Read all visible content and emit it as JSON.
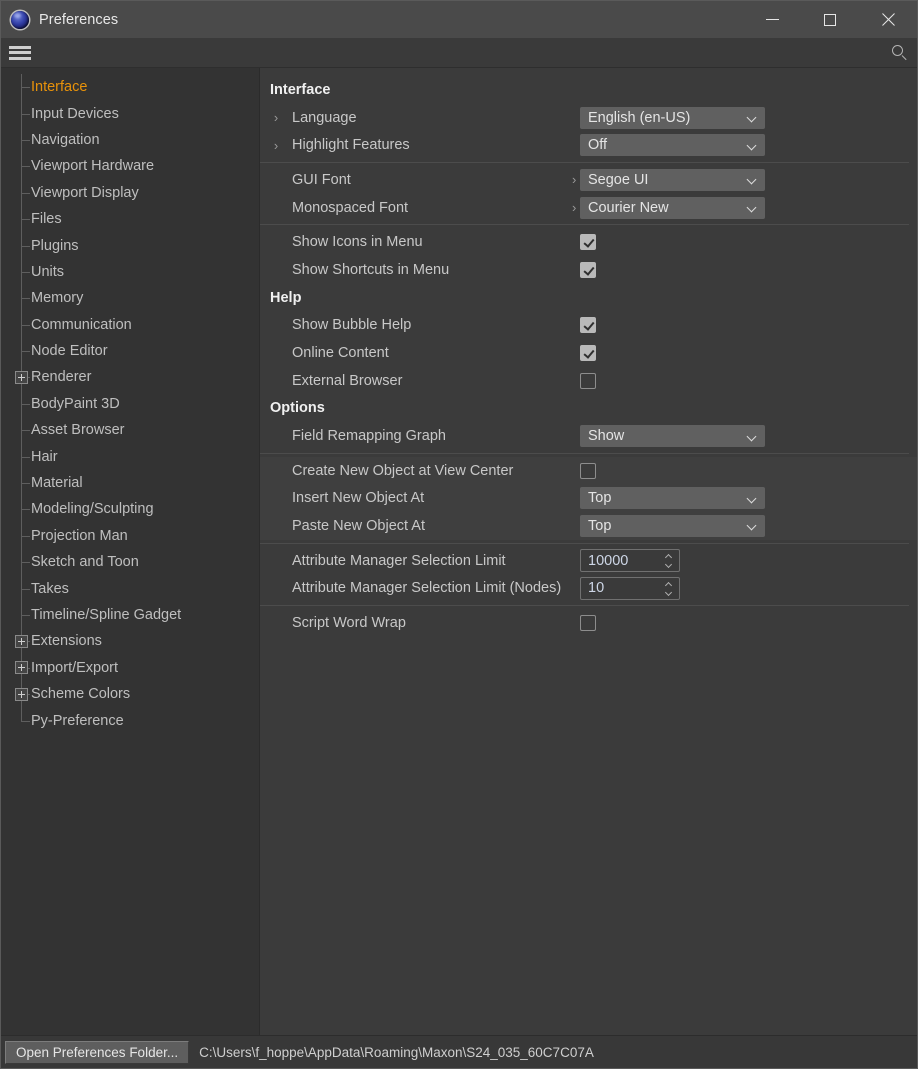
{
  "window": {
    "title": "Preferences",
    "app_icon": "cinema4d-logo-icon",
    "minimize_label": "–",
    "maximize_label": "□",
    "close_label": "×"
  },
  "toolbar": {
    "menu_icon": "hamburger-menu-icon",
    "search_icon": "search-icon"
  },
  "sidebar": {
    "items": [
      {
        "label": "Interface",
        "expandable": false,
        "selected": true,
        "last": false
      },
      {
        "label": "Input Devices",
        "expandable": false,
        "selected": false,
        "last": false
      },
      {
        "label": "Navigation",
        "expandable": false,
        "selected": false,
        "last": false
      },
      {
        "label": "Viewport Hardware",
        "expandable": false,
        "selected": false,
        "last": false
      },
      {
        "label": "Viewport Display",
        "expandable": false,
        "selected": false,
        "last": false
      },
      {
        "label": "Files",
        "expandable": false,
        "selected": false,
        "last": false
      },
      {
        "label": "Plugins",
        "expandable": false,
        "selected": false,
        "last": false
      },
      {
        "label": "Units",
        "expandable": false,
        "selected": false,
        "last": false
      },
      {
        "label": "Memory",
        "expandable": false,
        "selected": false,
        "last": false
      },
      {
        "label": "Communication",
        "expandable": false,
        "selected": false,
        "last": false
      },
      {
        "label": "Node Editor",
        "expandable": false,
        "selected": false,
        "last": false
      },
      {
        "label": "Renderer",
        "expandable": true,
        "selected": false,
        "last": false
      },
      {
        "label": "BodyPaint 3D",
        "expandable": false,
        "selected": false,
        "last": false
      },
      {
        "label": "Asset Browser",
        "expandable": false,
        "selected": false,
        "last": false
      },
      {
        "label": "Hair",
        "expandable": false,
        "selected": false,
        "last": false
      },
      {
        "label": "Material",
        "expandable": false,
        "selected": false,
        "last": false
      },
      {
        "label": "Modeling/Sculpting",
        "expandable": false,
        "selected": false,
        "last": false
      },
      {
        "label": "Projection Man",
        "expandable": false,
        "selected": false,
        "last": false
      },
      {
        "label": "Sketch and Toon",
        "expandable": false,
        "selected": false,
        "last": false
      },
      {
        "label": "Takes",
        "expandable": false,
        "selected": false,
        "last": false
      },
      {
        "label": "Timeline/Spline Gadget",
        "expandable": false,
        "selected": false,
        "last": false
      },
      {
        "label": "Extensions",
        "expandable": true,
        "selected": false,
        "last": false
      },
      {
        "label": "Import/Export",
        "expandable": true,
        "selected": false,
        "last": false
      },
      {
        "label": "Scheme Colors",
        "expandable": true,
        "selected": false,
        "last": false
      },
      {
        "label": "Py-Preference",
        "expandable": false,
        "selected": false,
        "last": true
      }
    ]
  },
  "content": {
    "sections": [
      {
        "heading": "Interface",
        "rows": [
          {
            "kind": "dropdown",
            "arrow": true,
            "label": "Language",
            "value": "English (en-US)"
          },
          {
            "kind": "dropdown",
            "arrow": true,
            "label": "Highlight Features",
            "value": "Off"
          },
          {
            "kind": "sep"
          },
          {
            "kind": "dropdown",
            "arrow": false,
            "pre_arrow": true,
            "label": "GUI Font",
            "value": "Segoe UI"
          },
          {
            "kind": "dropdown",
            "arrow": false,
            "pre_arrow": true,
            "label": "Monospaced Font",
            "value": "Courier New"
          },
          {
            "kind": "sep"
          },
          {
            "kind": "checkbox",
            "label": "Show Icons in Menu",
            "checked": true
          },
          {
            "kind": "checkbox",
            "label": "Show Shortcuts in Menu",
            "checked": true
          }
        ]
      },
      {
        "heading": "Help",
        "rows": [
          {
            "kind": "checkbox",
            "label": "Show Bubble Help",
            "checked": true
          },
          {
            "kind": "checkbox",
            "label": "Online Content",
            "checked": true
          },
          {
            "kind": "checkbox",
            "label": "External Browser",
            "checked": false
          }
        ]
      },
      {
        "heading": "Options",
        "rows": [
          {
            "kind": "dropdown",
            "arrow": false,
            "label": "Field Remapping Graph",
            "value": "Show"
          },
          {
            "kind": "sep"
          },
          {
            "kind": "checkbox",
            "label": "Create New Object at View Center",
            "checked": false,
            "band": true
          },
          {
            "kind": "dropdown",
            "arrow": false,
            "label": "Insert New Object At",
            "value": "Top",
            "band": true
          },
          {
            "kind": "dropdown",
            "arrow": false,
            "label": "Paste New Object At",
            "value": "Top",
            "band": true
          },
          {
            "kind": "sep"
          },
          {
            "kind": "number",
            "label": "Attribute Manager Selection Limit",
            "value": "10000"
          },
          {
            "kind": "number",
            "label": "Attribute Manager Selection Limit (Nodes)",
            "value": "10"
          },
          {
            "kind": "sep"
          },
          {
            "kind": "checkbox",
            "label": "Script Word Wrap",
            "checked": false
          }
        ]
      }
    ]
  },
  "footer": {
    "button_label": "Open Preferences Folder...",
    "path": "C:\\Users\\f_hoppe\\AppData\\Roaming\\Maxon\\S24_035_60C7C07A"
  },
  "colors": {
    "accent_selected": "#e8920a",
    "titlebar_bg": "#4a4a4a",
    "panel_bg": "#3b3b3b",
    "tree_bg": "#333333",
    "control_bg": "#606060"
  }
}
